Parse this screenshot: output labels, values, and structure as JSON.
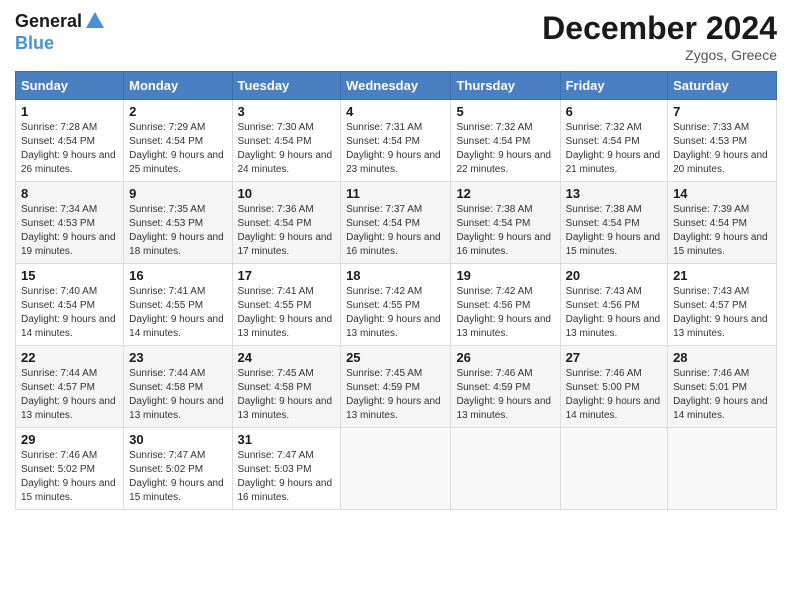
{
  "header": {
    "logo_line1": "General",
    "logo_line2": "Blue",
    "month": "December 2024",
    "location": "Zygos, Greece"
  },
  "days_of_week": [
    "Sunday",
    "Monday",
    "Tuesday",
    "Wednesday",
    "Thursday",
    "Friday",
    "Saturday"
  ],
  "weeks": [
    [
      {
        "day": "1",
        "sunrise": "7:28 AM",
        "sunset": "4:54 PM",
        "daylight": "9 hours and 26 minutes."
      },
      {
        "day": "2",
        "sunrise": "7:29 AM",
        "sunset": "4:54 PM",
        "daylight": "9 hours and 25 minutes."
      },
      {
        "day": "3",
        "sunrise": "7:30 AM",
        "sunset": "4:54 PM",
        "daylight": "9 hours and 24 minutes."
      },
      {
        "day": "4",
        "sunrise": "7:31 AM",
        "sunset": "4:54 PM",
        "daylight": "9 hours and 23 minutes."
      },
      {
        "day": "5",
        "sunrise": "7:32 AM",
        "sunset": "4:54 PM",
        "daylight": "9 hours and 22 minutes."
      },
      {
        "day": "6",
        "sunrise": "7:32 AM",
        "sunset": "4:54 PM",
        "daylight": "9 hours and 21 minutes."
      },
      {
        "day": "7",
        "sunrise": "7:33 AM",
        "sunset": "4:53 PM",
        "daylight": "9 hours and 20 minutes."
      }
    ],
    [
      {
        "day": "8",
        "sunrise": "7:34 AM",
        "sunset": "4:53 PM",
        "daylight": "9 hours and 19 minutes."
      },
      {
        "day": "9",
        "sunrise": "7:35 AM",
        "sunset": "4:53 PM",
        "daylight": "9 hours and 18 minutes."
      },
      {
        "day": "10",
        "sunrise": "7:36 AM",
        "sunset": "4:54 PM",
        "daylight": "9 hours and 17 minutes."
      },
      {
        "day": "11",
        "sunrise": "7:37 AM",
        "sunset": "4:54 PM",
        "daylight": "9 hours and 16 minutes."
      },
      {
        "day": "12",
        "sunrise": "7:38 AM",
        "sunset": "4:54 PM",
        "daylight": "9 hours and 16 minutes."
      },
      {
        "day": "13",
        "sunrise": "7:38 AM",
        "sunset": "4:54 PM",
        "daylight": "9 hours and 15 minutes."
      },
      {
        "day": "14",
        "sunrise": "7:39 AM",
        "sunset": "4:54 PM",
        "daylight": "9 hours and 15 minutes."
      }
    ],
    [
      {
        "day": "15",
        "sunrise": "7:40 AM",
        "sunset": "4:54 PM",
        "daylight": "9 hours and 14 minutes."
      },
      {
        "day": "16",
        "sunrise": "7:41 AM",
        "sunset": "4:55 PM",
        "daylight": "9 hours and 14 minutes."
      },
      {
        "day": "17",
        "sunrise": "7:41 AM",
        "sunset": "4:55 PM",
        "daylight": "9 hours and 13 minutes."
      },
      {
        "day": "18",
        "sunrise": "7:42 AM",
        "sunset": "4:55 PM",
        "daylight": "9 hours and 13 minutes."
      },
      {
        "day": "19",
        "sunrise": "7:42 AM",
        "sunset": "4:56 PM",
        "daylight": "9 hours and 13 minutes."
      },
      {
        "day": "20",
        "sunrise": "7:43 AM",
        "sunset": "4:56 PM",
        "daylight": "9 hours and 13 minutes."
      },
      {
        "day": "21",
        "sunrise": "7:43 AM",
        "sunset": "4:57 PM",
        "daylight": "9 hours and 13 minutes."
      }
    ],
    [
      {
        "day": "22",
        "sunrise": "7:44 AM",
        "sunset": "4:57 PM",
        "daylight": "9 hours and 13 minutes."
      },
      {
        "day": "23",
        "sunrise": "7:44 AM",
        "sunset": "4:58 PM",
        "daylight": "9 hours and 13 minutes."
      },
      {
        "day": "24",
        "sunrise": "7:45 AM",
        "sunset": "4:58 PM",
        "daylight": "9 hours and 13 minutes."
      },
      {
        "day": "25",
        "sunrise": "7:45 AM",
        "sunset": "4:59 PM",
        "daylight": "9 hours and 13 minutes."
      },
      {
        "day": "26",
        "sunrise": "7:46 AM",
        "sunset": "4:59 PM",
        "daylight": "9 hours and 13 minutes."
      },
      {
        "day": "27",
        "sunrise": "7:46 AM",
        "sunset": "5:00 PM",
        "daylight": "9 hours and 14 minutes."
      },
      {
        "day": "28",
        "sunrise": "7:46 AM",
        "sunset": "5:01 PM",
        "daylight": "9 hours and 14 minutes."
      }
    ],
    [
      {
        "day": "29",
        "sunrise": "7:46 AM",
        "sunset": "5:02 PM",
        "daylight": "9 hours and 15 minutes."
      },
      {
        "day": "30",
        "sunrise": "7:47 AM",
        "sunset": "5:02 PM",
        "daylight": "9 hours and 15 minutes."
      },
      {
        "day": "31",
        "sunrise": "7:47 AM",
        "sunset": "5:03 PM",
        "daylight": "9 hours and 16 minutes."
      },
      null,
      null,
      null,
      null
    ]
  ],
  "labels": {
    "sunrise": "Sunrise:",
    "sunset": "Sunset:",
    "daylight": "Daylight:"
  }
}
